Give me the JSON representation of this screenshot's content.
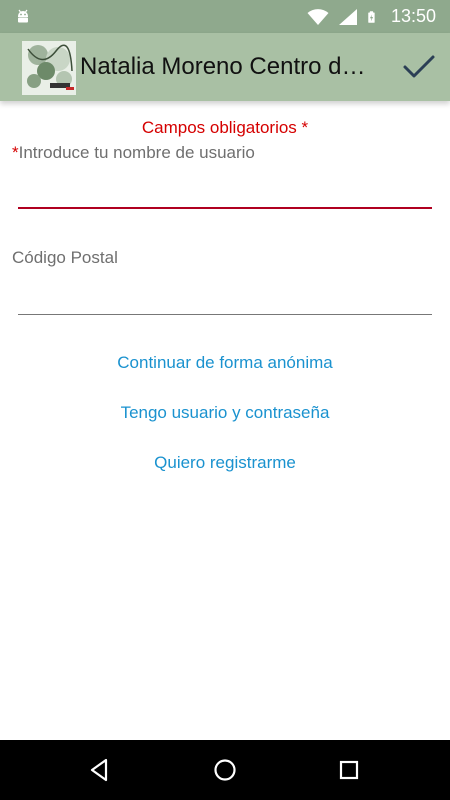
{
  "status_bar": {
    "time": "13:50",
    "icons": [
      "android-notification-icon",
      "wifi-icon",
      "signal-icon",
      "battery-charging-icon"
    ]
  },
  "app_bar": {
    "title": "Natalia Moreno Centro d…",
    "logo_icon": "salon-logo-icon",
    "confirm_icon": "checkmark-icon"
  },
  "form": {
    "required_note": "Campos obligatorios *",
    "username": {
      "required_marker": "*",
      "label": "Introduce tu nombre de usuario",
      "value": ""
    },
    "postal_code": {
      "label": "Código Postal",
      "value": ""
    }
  },
  "links": {
    "anonymous": "Continuar de forma anónima",
    "have_account": "Tengo usuario y contraseña",
    "register": "Quiero registrarme"
  },
  "nav_bar": {
    "icons": [
      "back-icon",
      "home-icon",
      "recents-icon"
    ]
  },
  "colors": {
    "status_bar": "#8fa98d",
    "app_bar": "#a9c0a4",
    "required_red": "#d50000",
    "link_blue": "#1a92cf",
    "active_underline": "#b00020"
  }
}
